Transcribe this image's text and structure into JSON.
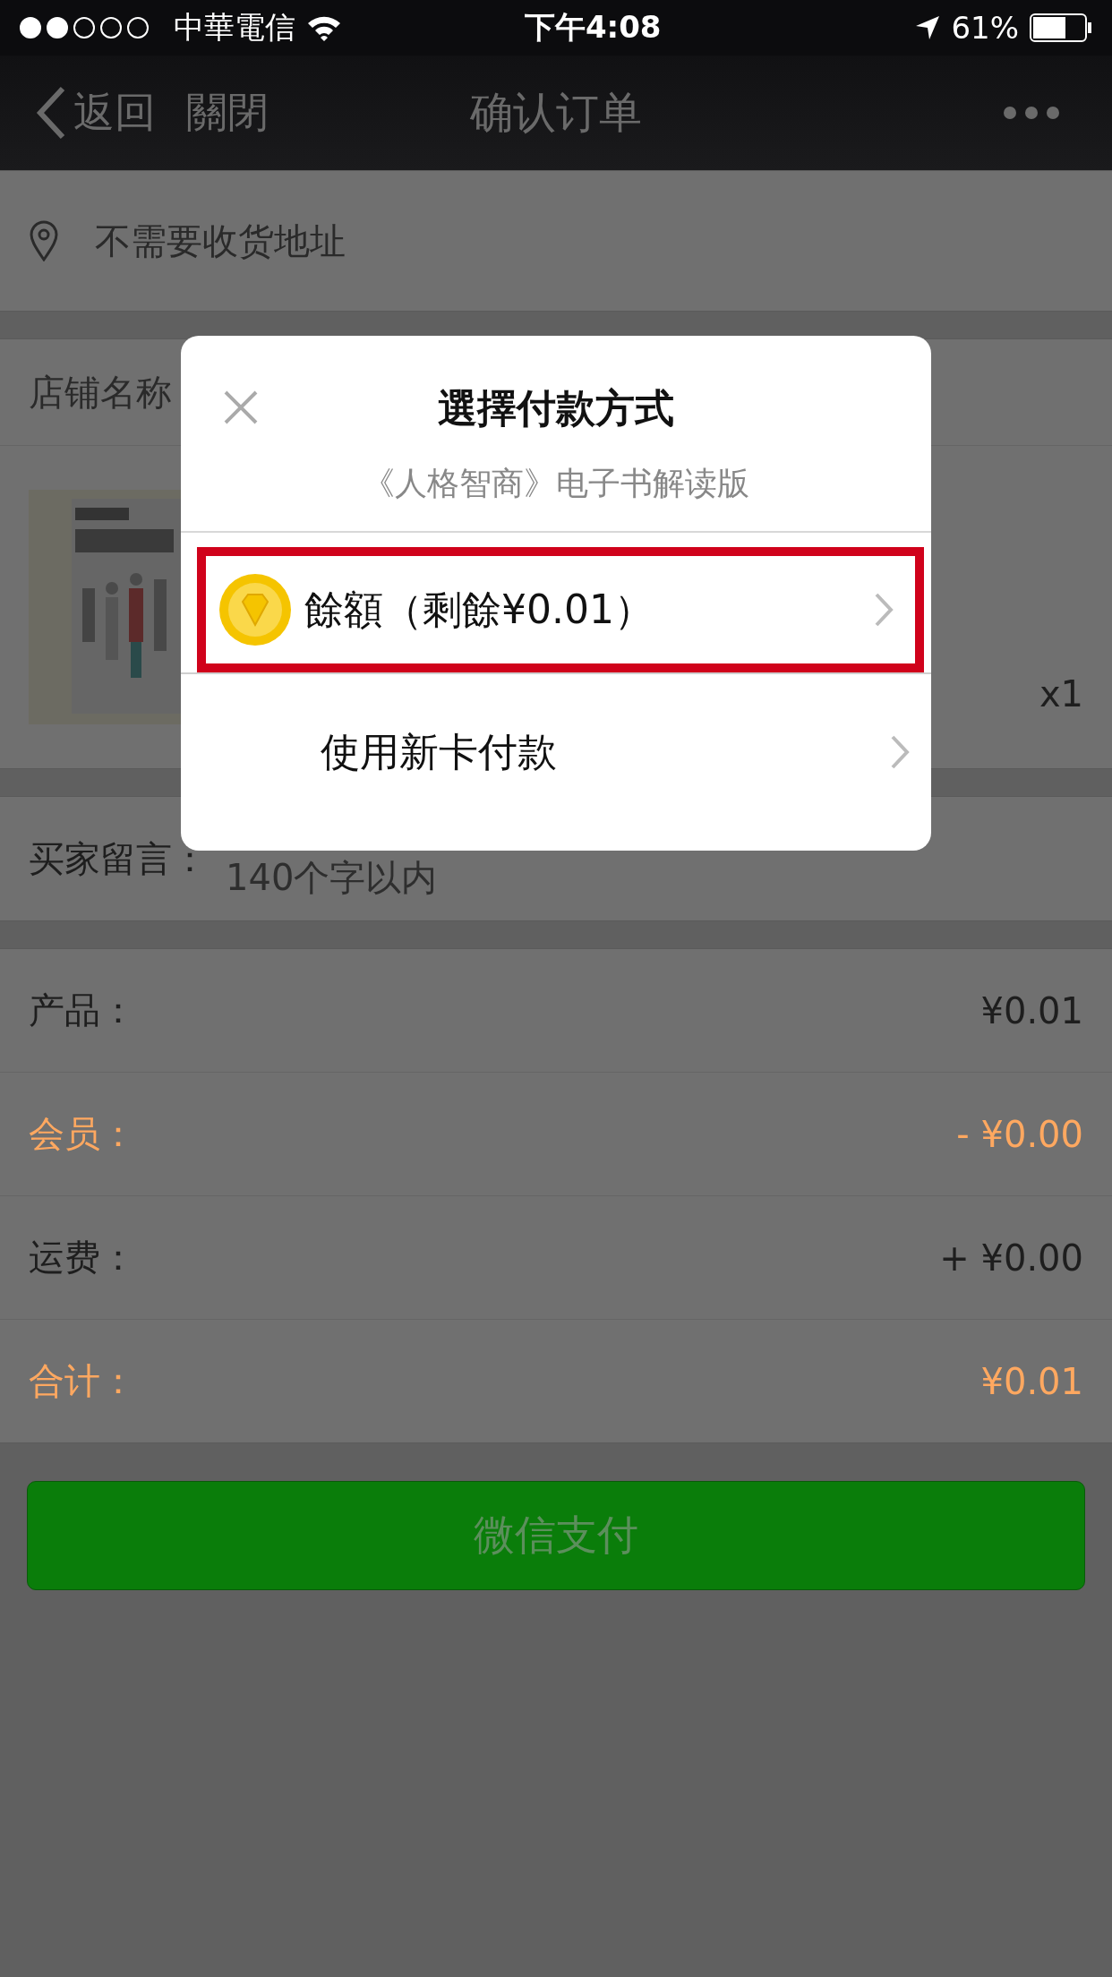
{
  "status_bar": {
    "carrier": "中華電信",
    "time": "下午4:08",
    "battery": "61%"
  },
  "nav": {
    "back": "返回",
    "close": "關閉",
    "title": "确认订单"
  },
  "address": {
    "text": "不需要收货地址"
  },
  "shop": {
    "name": "店铺名称"
  },
  "product": {
    "kind": "picture",
    "quantity": "x1"
  },
  "message": {
    "label": "买家留言：",
    "placeholder": "140个字以内"
  },
  "summary": [
    {
      "label": "产品：",
      "value": "¥0.01",
      "highlighted": false
    },
    {
      "label": "会员：",
      "value": "- ¥0.00",
      "highlighted": true
    },
    {
      "label": "运费：",
      "value": "+ ¥0.00",
      "highlighted": false
    },
    {
      "label": "合计：",
      "value": "¥0.01",
      "highlighted": true
    }
  ],
  "pay_button": "微信支付",
  "dialog": {
    "title": "選擇付款方式",
    "subtitle": "《人格智商》电子书解读版",
    "options": [
      {
        "kind": "balance",
        "label": "餘額（剩餘¥0.01）",
        "highlighted": true
      },
      {
        "kind": "card",
        "label": "使用新卡付款",
        "highlighted": false
      }
    ]
  }
}
